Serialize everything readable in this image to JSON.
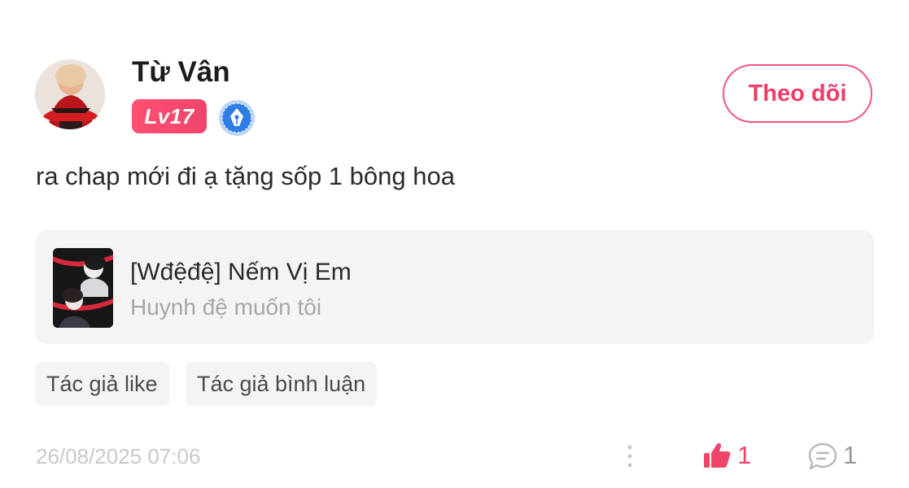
{
  "user": {
    "name": "Từ Vân",
    "level": "Lv17"
  },
  "follow_label": "Theo dõi",
  "comment": {
    "text": "ra chap mới đi ạ tặng sốp 1 bông hoa"
  },
  "book": {
    "title": "[Wđệđệ] Nếm Vị Em",
    "subtitle": "Huynh đệ muốn tôi"
  },
  "tags": [
    "Tác giả like",
    "Tác giả bình luận"
  ],
  "footer": {
    "timestamp": "26/08/2025 07:06",
    "like_count": "1",
    "comment_count": "1"
  },
  "colors": {
    "accent": "#f0456a",
    "badge": "#2f7ee8",
    "card_bg": "#f4f4f4"
  },
  "icons": {
    "writer_badge": "pen-nib-badge-icon",
    "like": "thumbs-up-icon",
    "comment": "comment-bubble-icon",
    "more": "vertical-dots-icon"
  }
}
